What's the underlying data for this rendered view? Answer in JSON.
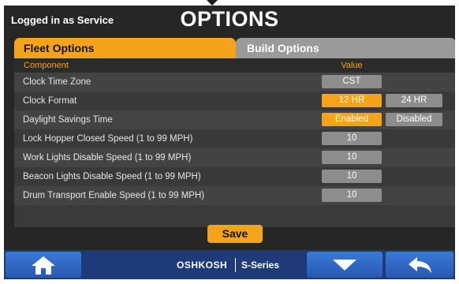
{
  "header": {
    "login_text": "Logged in as Service",
    "title": "OPTIONS"
  },
  "tabs": [
    {
      "label": "Fleet Options",
      "active": true
    },
    {
      "label": "Build Options",
      "active": false
    }
  ],
  "table": {
    "col_component": "Component",
    "col_value": "Value",
    "rows": [
      {
        "label": "Clock Time Zone",
        "values": [
          "CST"
        ],
        "selected": null
      },
      {
        "label": "Clock Format",
        "values": [
          "12 HR",
          "24 HR"
        ],
        "selected": 0
      },
      {
        "label": "Daylight Savings Time",
        "values": [
          "Enabled",
          "Disabled"
        ],
        "selected": 0
      },
      {
        "label": "Lock Hopper Closed Speed (1 to 99 MPH)",
        "values": [
          "10"
        ],
        "selected": null
      },
      {
        "label": "Work Lights Disable Speed (1 to 99 MPH)",
        "values": [
          "10"
        ],
        "selected": null
      },
      {
        "label": "Beacon Lights Disable Speed (1 to 99 MPH)",
        "values": [
          "10"
        ],
        "selected": null
      },
      {
        "label": "Drum Transport Enable Speed (1 to 99 MPH)",
        "values": [
          "10"
        ],
        "selected": null
      }
    ]
  },
  "save_label": "Save",
  "footer": {
    "brand_logo": "OSHKOSH",
    "brand_series": "S-Series",
    "home_icon": "home-icon",
    "down_icon": "chevron-down-icon",
    "back_icon": "back-arrow-icon"
  },
  "colors": {
    "accent": "#f5a31a",
    "inactive_value": "#8d8d8d",
    "footer_blue": "#2d66c4"
  }
}
